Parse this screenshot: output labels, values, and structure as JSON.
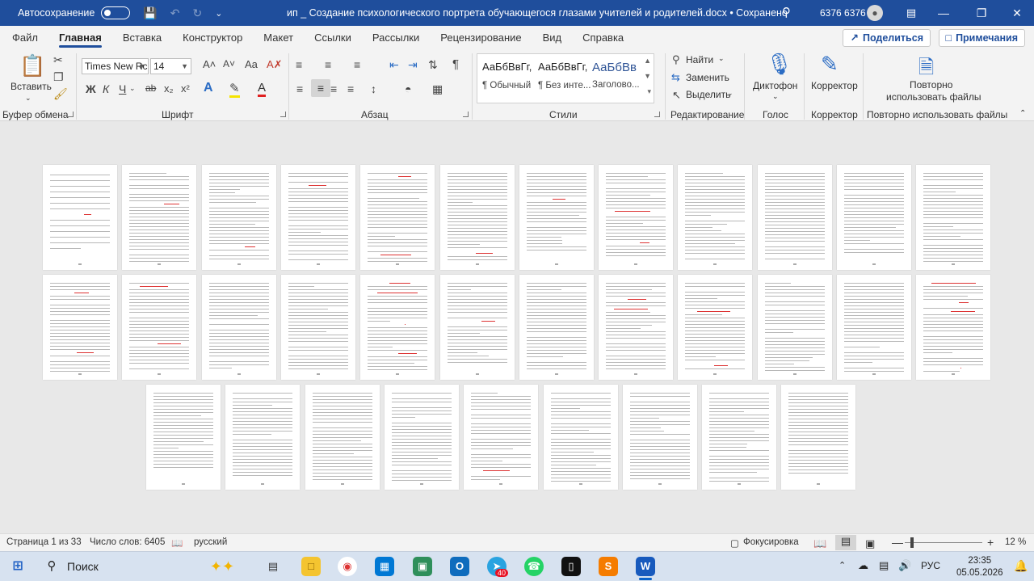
{
  "titlebar": {
    "autosave_label": "Автосохранение",
    "title": "ип _ Создание психологического портрета обучающегося глазами учителей и родителей.docx  •  Сохранено",
    "user": "6376 6376"
  },
  "tabs": [
    "Файл",
    "Главная",
    "Вставка",
    "Конструктор",
    "Макет",
    "Ссылки",
    "Рассылки",
    "Рецензирование",
    "Вид",
    "Справка"
  ],
  "active_tab": "Главная",
  "share_label": "Поделиться",
  "notes_label": "Примечания",
  "ribbon": {
    "clipboard": {
      "paste_label": "Вставить",
      "group": "Буфер обмена"
    },
    "font": {
      "name": "Times New Rc",
      "size": "14",
      "group": "Шрифт"
    },
    "paragraph": {
      "group": "Абзац"
    },
    "styles": {
      "group": "Стили",
      "items": [
        {
          "sample": "АаБбВвГг,",
          "name": "¶ Обычный"
        },
        {
          "sample": "АаБбВвГг,",
          "name": "¶ Без инте..."
        },
        {
          "sample": "АаБбВв",
          "name": "Заголово..."
        }
      ]
    },
    "editing": {
      "find": "Найти",
      "replace": "Заменить",
      "select": "Выделить",
      "group": "Редактирование"
    },
    "voice": {
      "dictate": "Диктофон",
      "group": "Голос"
    },
    "editor": {
      "label": "Корректор",
      "group": "Корректор"
    },
    "reuse": {
      "label_line1": "Повторно",
      "label_line2": "использовать файлы",
      "group": "Повторно использовать файлы"
    }
  },
  "status": {
    "page": "Страница 1 из 33",
    "words": "Число слов: 6405",
    "language": "русский",
    "focus": "Фокусировка",
    "zoom": "12 %"
  },
  "taskbar": {
    "search": "Поиск",
    "lang": "РУС",
    "time": "23:35",
    "date": "05.05.2026",
    "badge": "40"
  },
  "document": {
    "page_rows": [
      12,
      12,
      9
    ]
  }
}
